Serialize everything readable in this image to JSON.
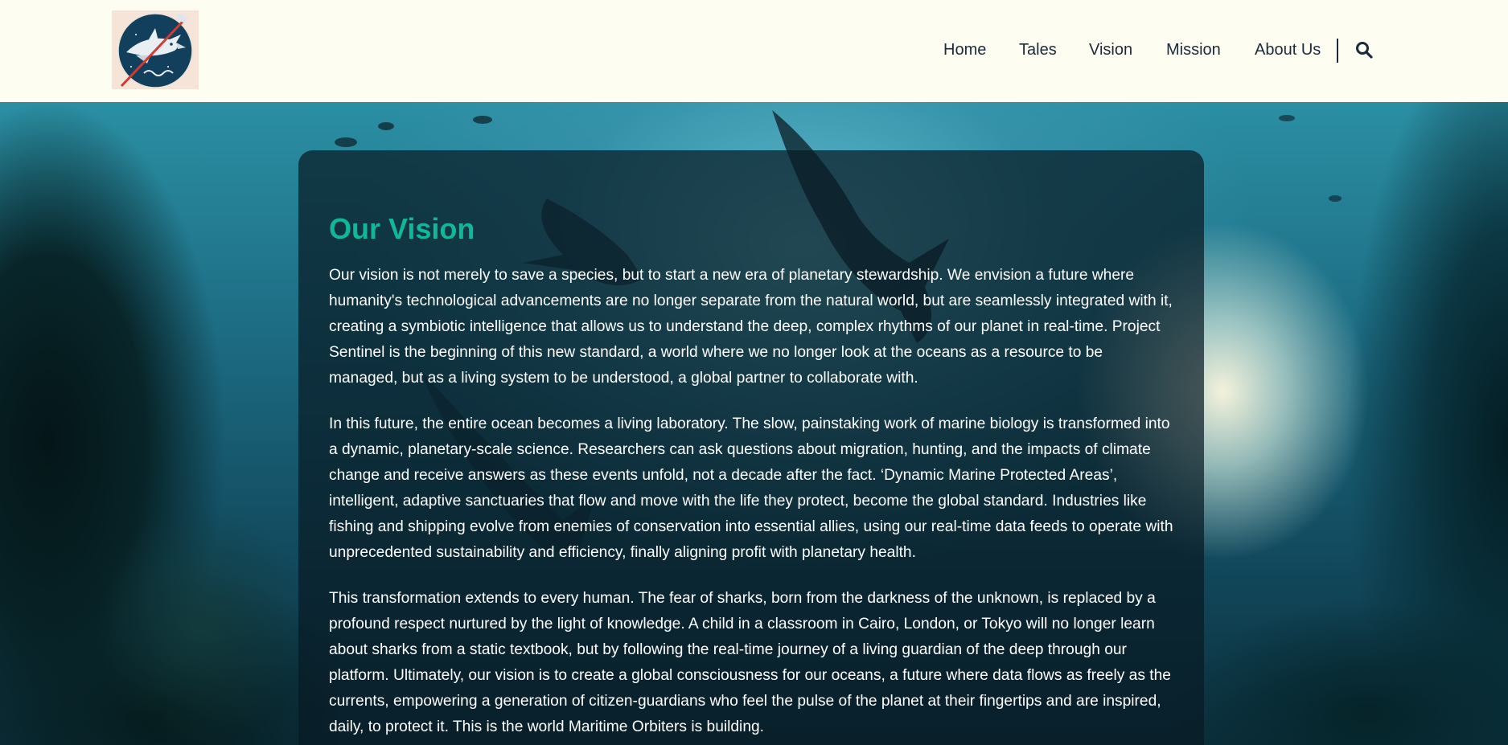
{
  "header": {
    "logo_icon": "shark-satellite-emblem-icon",
    "nav": [
      {
        "label": "Home"
      },
      {
        "label": "Tales"
      },
      {
        "label": "Vision"
      },
      {
        "label": "Mission"
      },
      {
        "label": "About Us"
      }
    ],
    "search_icon": "search-icon"
  },
  "main": {
    "title": "Our Vision",
    "paragraphs": [
      "Our vision is not merely to save a species, but to start a new era of planetary stewardship. We envision a future where humanity's technological advancements are no longer separate from the natural world, but are seamlessly integrated with it, creating a symbiotic intelligence that allows us to understand the deep, complex rhythms of our planet in real-time. Project Sentinel is the beginning of this new standard, a world where we no longer look at the oceans as a resource to be managed, but as a living system to be understood, a global partner to collaborate with.",
      "In this future, the entire ocean becomes a living laboratory. The slow, painstaking work of marine biology is transformed into a dynamic, planetary-scale science. Researchers can ask questions about migration, hunting, and the impacts of climate change and receive answers as these events unfold, not a decade after the fact. ‘Dynamic Marine Protected Areas’, intelligent, adaptive sanctuaries that flow and move with the life they protect, become the global standard. Industries like fishing and shipping evolve from enemies of conservation into essential allies, using our real-time data feeds to operate with unprecedented sustainability and efficiency, finally aligning profit with planetary health.",
      "This transformation extends to every human. The fear of sharks, born from the darkness of the unknown, is replaced by a profound respect nurtured by the light of knowledge. A child in a classroom in Cairo, London, or Tokyo will no longer learn about sharks from a static textbook, but by following the real-time journey of a living guardian of the deep through our platform. Ultimately, our vision is to create a global consciousness for our oceans, a future where data flows as freely as the currents, empowering a generation of citizen-guardians who feel the pulse of the planet at their fingertips and are inspired, daily, to protect it. This is the world Maritime Orbiters is building."
    ]
  },
  "colors": {
    "header_bg": "#fdfdf1",
    "title_accent": "#12b79a",
    "nav_text": "#1c2a3a",
    "card_bg": "rgba(8,26,36,0.72)"
  }
}
